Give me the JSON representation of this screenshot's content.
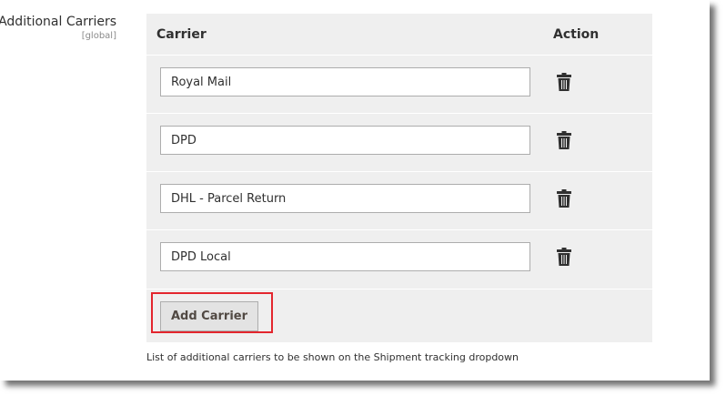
{
  "field": {
    "label": "Additional Carriers",
    "scope": "[global]"
  },
  "grid": {
    "columns": {
      "carrier": "Carrier",
      "action": "Action"
    },
    "rows": [
      {
        "value": "Royal Mail",
        "action_icon": "trash-icon"
      },
      {
        "value": "DPD",
        "action_icon": "trash-icon"
      },
      {
        "value": "DHL - Parcel Return",
        "action_icon": "trash-icon"
      },
      {
        "value": "DPD Local",
        "action_icon": "trash-icon"
      }
    ],
    "add_button_label": "Add Carrier"
  },
  "note": "List of additional carriers to be shown on the Shipment tracking dropdown",
  "colors": {
    "highlight": "#e3262e",
    "grid_background": "#efefef",
    "button_background": "#e3e3e3"
  }
}
